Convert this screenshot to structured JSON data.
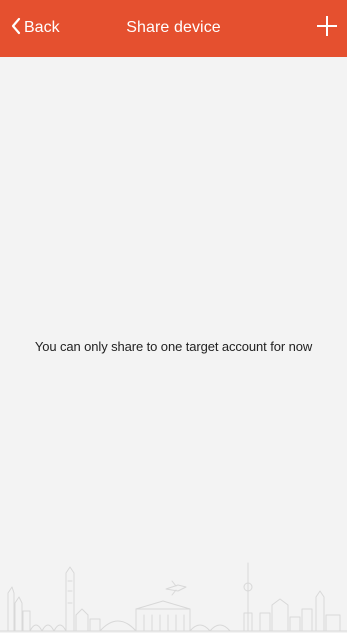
{
  "header": {
    "back_label": "Back",
    "title": "Share device",
    "add_icon": "plus-icon",
    "back_icon": "chevron-left-icon"
  },
  "main": {
    "message": "You can only share to one target account for now"
  },
  "decor": {
    "skyline_icon": "city-skyline-illustration"
  },
  "colors": {
    "header_bg": "#e5502f",
    "page_bg": "#f3f3f3",
    "text": "#222222"
  }
}
